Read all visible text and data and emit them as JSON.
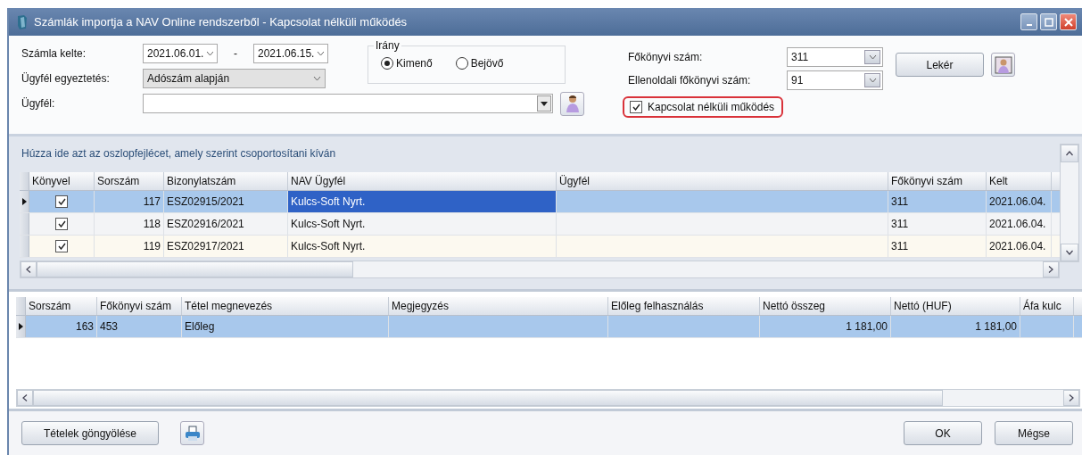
{
  "window": {
    "title": "Számlák importja a NAV Online rendszerből - Kapcsolat nélküli működés"
  },
  "filters": {
    "date_label": "Számla kelte:",
    "date_from": "2021.06.01.",
    "date_separator": "-",
    "date_to": "2021.06.15.",
    "matching_label": "Ügyfél egyeztetés:",
    "matching_value": "Adószám alapján",
    "customer_label": "Ügyfél:"
  },
  "direction": {
    "legend": "Irány",
    "options": [
      {
        "label": "Kimenő",
        "selected": true
      },
      {
        "label": "Bejövő",
        "selected": false
      }
    ]
  },
  "ledger": {
    "account_label": "Főkönyvi szám:",
    "account_value": "311",
    "contra_label": "Ellenoldali főkönyvi szám:",
    "contra_value": "91"
  },
  "offline_mode": {
    "label": "Kapcsolat nélküli működés",
    "checked": true
  },
  "query_button": "Lekér",
  "invoices": {
    "group_hint": "Húzza ide azt az oszlopfejlécet, amely szerint csoportosítani kíván",
    "columns": [
      "Könyvel",
      "Sorszám",
      "Bizonylatszám",
      "NAV Ügyfél",
      "Ügyfél",
      "Főkönyvi szám",
      "Kelt"
    ],
    "rows": [
      {
        "selected": true,
        "nav_customer_focused": true,
        "booked": true,
        "number": "117",
        "document": "ESZ02915/2021",
        "nav_customer": "Kulcs-Soft Nyrt.",
        "account": "311",
        "date": "2021.06.04."
      },
      {
        "selected": false,
        "nav_customer_focused": false,
        "booked": true,
        "number": "118",
        "document": "ESZ02916/2021",
        "nav_customer": "Kulcs-Soft Nyrt.",
        "account": "311",
        "date": "2021.06.04."
      },
      {
        "selected": false,
        "nav_customer_focused": false,
        "booked": true,
        "number": "119",
        "document": "ESZ02917/2021",
        "nav_customer": "Kulcs-Soft Nyrt.",
        "account": "311",
        "date": "2021.06.04."
      }
    ]
  },
  "items": {
    "columns": [
      "Sorszám",
      "Főkönyvi szám",
      "Tétel megnevezés",
      "Megjegyzés",
      "Előleg felhasználás",
      "Nettó összeg",
      "Nettó (HUF)",
      "Áfa kulc"
    ],
    "rows": [
      {
        "selected": true,
        "number": "163",
        "account": "453",
        "name": "Előleg",
        "net_amount": "1 181,00",
        "net_huf": "1 181,00"
      }
    ]
  },
  "footer": {
    "rollup_button": "Tételek göngyölése",
    "ok_button": "OK",
    "cancel_button": "Mégse"
  }
}
